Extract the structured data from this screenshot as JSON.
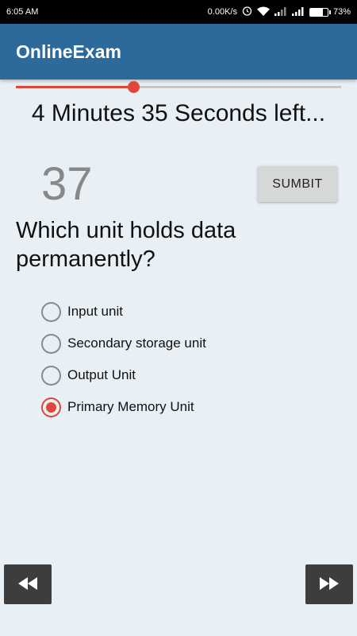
{
  "status_bar": {
    "time": "6:05 AM",
    "network_speed": "0.00K/s",
    "battery_percent": "73%",
    "battery_level": 0.73,
    "icons": [
      "alarm-icon",
      "wifi-icon",
      "signal-icon",
      "signal-icon",
      "battery-icon"
    ]
  },
  "app_bar": {
    "title": "OnlineExam"
  },
  "timer": {
    "progress": 0.36,
    "text": "4 Minutes 35 Seconds left..."
  },
  "question": {
    "number": "37",
    "text": "Which unit holds data permanently?",
    "options": [
      {
        "label": "Input unit",
        "selected": false
      },
      {
        "label": "Secondary storage unit",
        "selected": false
      },
      {
        "label": "Output Unit",
        "selected": false
      },
      {
        "label": "Primary Memory Unit",
        "selected": true
      }
    ]
  },
  "actions": {
    "submit_label": "SUMBIT",
    "prev_icon": "rewind-icon",
    "next_icon": "fast-forward-icon"
  },
  "colors": {
    "app_bar": "#2b6a9a",
    "accent": "#e0463a",
    "background": "#e8eff5",
    "nav_button": "#3d3d3d"
  }
}
